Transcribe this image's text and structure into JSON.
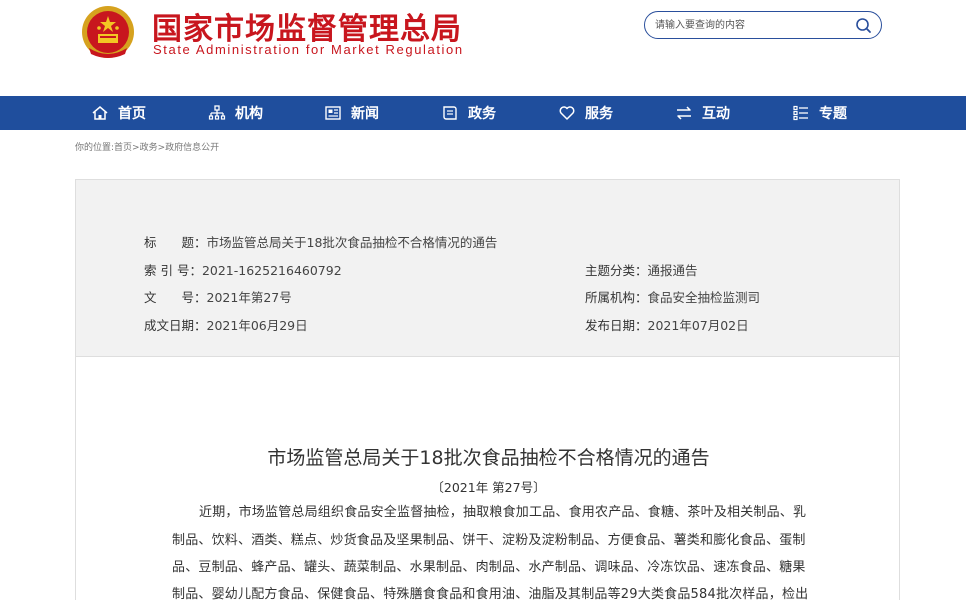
{
  "header": {
    "title": "国家市场监督管理总局",
    "subtitle": "State Administration for Market Regulation",
    "emblem_icon": "national-emblem",
    "search_placeholder": "请输入要查询的内容",
    "search_icon": "search-icon"
  },
  "nav": {
    "items": [
      {
        "label": "首页",
        "icon": "home-icon"
      },
      {
        "label": "机构",
        "icon": "org-chart-icon"
      },
      {
        "label": "新闻",
        "icon": "news-icon"
      },
      {
        "label": "政务",
        "icon": "book-icon"
      },
      {
        "label": "服务",
        "icon": "heart-icon"
      },
      {
        "label": "互动",
        "icon": "exchange-icon"
      },
      {
        "label": "专题",
        "icon": "list-icon"
      }
    ]
  },
  "breadcrumb": "你的位置:首页>政务>政府信息公开",
  "meta": {
    "title_key": "标　　题：",
    "title_value": "市场监管总局关于18批次食品抽检不合格情况的通告",
    "index_key": "索 引 号：",
    "index_value": "2021-1625216460792",
    "doc_no_key": "文　　号：",
    "doc_no_value": "2021年第27号",
    "created_key": "成文日期：",
    "created_value": "2021年06月29日",
    "topic_key": "主题分类：",
    "topic_value": "通报通告",
    "org_key": "所属机构：",
    "org_value": "食品安全抽检监测司",
    "published_key": "发布日期：",
    "published_value": "2021年07月02日"
  },
  "document": {
    "title": "市场监管总局关于18批次食品抽检不合格情况的通告",
    "number": "〔2021年 第27号〕",
    "lines": [
      "近期，市场监管总局组织食品安全监督抽检，抽取粮食加工品、食用农产品、食糖、茶叶及相关制品、乳",
      "制品、饮料、酒类、糕点、炒货食品及坚果制品、饼干、淀粉及淀粉制品、方便食品、薯类和膨化食品、蛋制",
      "品、豆制品、蜂产品、罐头、蔬菜制品、水果制品、肉制品、水产制品、调味品、冷冻饮品、速冻食品、糖果",
      "制品、婴幼儿配方食品、保健食品、特殊膳食食品和食用油、油脂及其制品等29大类食品584批次样品，检出"
    ]
  },
  "colors": {
    "brand_red": "#c8161e",
    "nav_blue": "#1f4e9d"
  }
}
